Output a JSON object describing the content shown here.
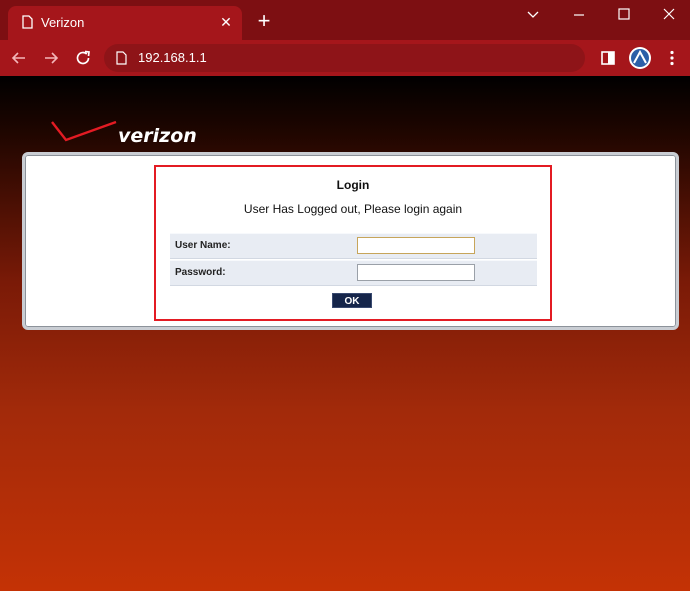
{
  "browser": {
    "tab": {
      "title": "Verizon",
      "close_glyph": "✕"
    },
    "new_tab_glyph": "+",
    "window_controls": {
      "collapse": "⌄",
      "minimize": "—",
      "maximize": "☐",
      "close": "✕"
    },
    "address": {
      "url": "192.168.1.1"
    },
    "icons": [
      "back-arrow-icon",
      "forward-arrow-icon",
      "reload-icon",
      "page-info-icon",
      "sidebar-icon",
      "profile-avatar-icon",
      "menu-dots-icon"
    ],
    "colors": {
      "chrome_dark": "#7d0f12",
      "chrome": "#a5161b",
      "omnibox": "#8e1418"
    }
  },
  "page": {
    "logo": {
      "text": "verizon",
      "check_color": "#e31b23"
    },
    "login": {
      "title": "Login",
      "message": "User Has Logged out, Please login again",
      "username_label": "User Name:",
      "username_value": "",
      "password_label": "Password:",
      "password_value": "",
      "ok_label": "OK"
    },
    "colors": {
      "highlight": "#e31b23",
      "ok_button": "#15254a",
      "row_bg": "#e8ecf3"
    }
  }
}
